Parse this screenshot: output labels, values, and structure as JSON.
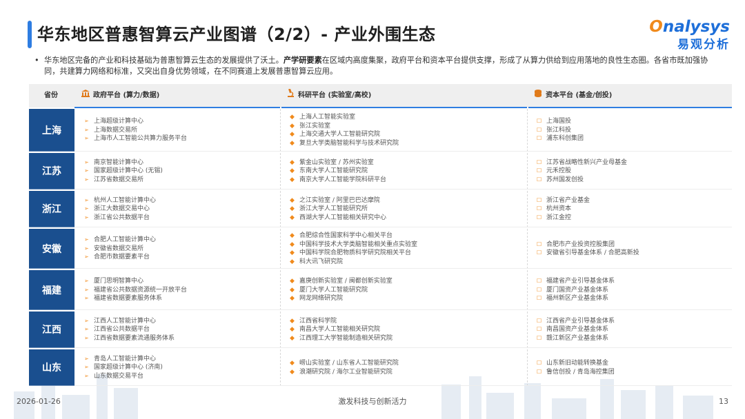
{
  "title": "华东地区普惠智算云产业图谱（2/2）- 产业外围生态",
  "logo": {
    "en_o": "O",
    "en_rest": "nalysys",
    "cn": "易观分析"
  },
  "intro": {
    "part1": "华东地区完备的产业和科技基础为普惠智算云生态的发展提供了沃土。",
    "bold": "产学研要素",
    "part2": "在区域内高度集聚，政府平台和资本平台提供支撑，形成了从算力供给到应用落地的良性生态圈。各省市既加强协同，共建算力网络和标准，又突出自身优势领域，在不同赛道上发展普惠智算云应用。"
  },
  "table": {
    "headers": {
      "province": "省份",
      "gov": "政府平台 (算力/数据)",
      "res": "科研平台 (实验室/高校)",
      "cap": "资本平台 (基金/创投)"
    },
    "rows": [
      {
        "province": "上海",
        "gov": [
          "上海超级计算中心",
          "上海数据交易所",
          "上海市人工智能公共算力服务平台"
        ],
        "res": [
          "上海人工智能实验室",
          "张江实验室",
          "上海交通大学人工智能研究院",
          "复旦大学类脑智能科学与技术研究院"
        ],
        "cap": [
          "上海国投",
          "张江科投",
          "浦东科创集团"
        ]
      },
      {
        "province": "江苏",
        "gov": [
          "南京智能计算中心",
          "国家超级计算中心 (无锡)",
          "江苏省数据交易所"
        ],
        "res": [
          "紫金山实验室 / 苏州实验室",
          "东南大学人工智能研究院",
          "南京大学人工智能学院科研平台"
        ],
        "cap": [
          "江苏省战略性新兴产业母基金",
          "元禾控股",
          "苏州国发创投"
        ]
      },
      {
        "province": "浙江",
        "gov": [
          "杭州人工智能计算中心",
          "浙江大数据交易中心",
          "浙江省公共数据平台"
        ],
        "res": [
          "之江实验室 / 阿里巴巴达摩院",
          "浙江大学人工智能研究所",
          "西湖大学人工智能相关研究中心"
        ],
        "cap": [
          "浙江省产业基金",
          "杭州资本",
          "浙江金控"
        ]
      },
      {
        "province": "安徽",
        "gov": [
          "合肥人工智能计算中心",
          "安徽省数据交易所",
          "合肥市数据要素平台"
        ],
        "res": [
          "合肥综合性国家科学中心相关平台",
          "中国科学技术大学类脑智能相关重点实验室",
          "中国科学院合肥物质科学研究院相关平台",
          "科大讯飞研究院"
        ],
        "cap": [
          "合肥市产业投资控股集团",
          "安徽省引导基金体系 / 合肥高新投"
        ]
      },
      {
        "province": "福建",
        "gov": [
          "厦门思明智算中心",
          "福建省公共数据资源统一开放平台",
          "福建省数据要素服务体系"
        ],
        "res": [
          "嘉庚创新实验室 / 闽都创新实验室",
          "厦门大学人工智能研究院",
          "网龙网络研究院"
        ],
        "cap": [
          "福建省产业引导基金体系",
          "厦门国资产业基金体系",
          "福州新区产业基金体系"
        ]
      },
      {
        "province": "江西",
        "gov": [
          "江西人工智能计算中心",
          "江西省公共数据平台",
          "江西省数据要素流通服务体系"
        ],
        "res": [
          "江西省科学院",
          "南昌大学人工智能相关研究院",
          "江西理工大学智能制造相关研究院"
        ],
        "cap": [
          "江西省产业引导基金体系",
          "南昌国资产业基金体系",
          "赣江新区产业基金体系"
        ]
      },
      {
        "province": "山东",
        "gov": [
          "青岛人工智能计算中心",
          "国家超级计算中心 (济南)",
          "山东数据交易平台"
        ],
        "res": [
          "崂山实验室 / 山东省人工智能研究院",
          "浪潮研究院 / 海尔工业智能研究院"
        ],
        "cap": [
          "山东新旧动能转换基金",
          "鲁信创投 / 青岛海控集团"
        ]
      }
    ]
  },
  "footer": {
    "date": "2026-01-26",
    "slogan": "激发科技与创新活力",
    "page": "13"
  },
  "colors": {
    "accent_blue": "#2e7de1",
    "province_bg": "#1a4f8f",
    "marker_orange": "#f08a1c"
  },
  "icons": {
    "gov": "government-building-icon",
    "res": "microscope-icon",
    "cap": "coin-stack-icon"
  }
}
